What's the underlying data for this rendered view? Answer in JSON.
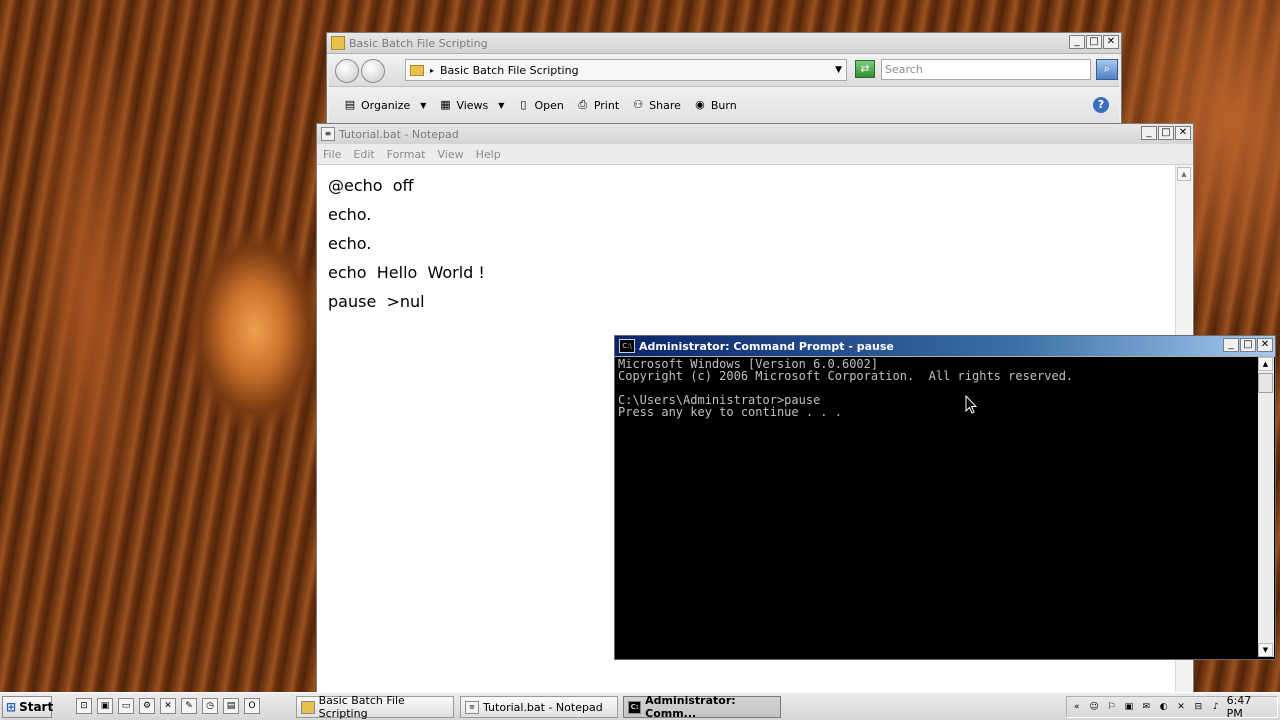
{
  "explorer": {
    "title": "Basic Batch File Scripting",
    "address": "Basic Batch File Scripting",
    "search_placeholder": "Search",
    "toolbar": {
      "organize": "Organize",
      "views": "Views",
      "open": "Open",
      "print": "Print",
      "share": "Share",
      "burn": "Burn"
    }
  },
  "notepad": {
    "title": "Tutorial.bat - Notepad",
    "menu": [
      "File",
      "Edit",
      "Format",
      "View",
      "Help"
    ],
    "lines": [
      "@echo  off",
      "echo.",
      "echo.",
      "echo  Hello  World !",
      "pause  >nul"
    ]
  },
  "cmd": {
    "title": "Administrator: Command Prompt - pause",
    "lines": [
      "Microsoft Windows [Version 6.0.6002]",
      "Copyright (c) 2006 Microsoft Corporation.  All rights reserved.",
      "",
      "C:\\Users\\Administrator>pause",
      "Press any key to continue . . ."
    ]
  },
  "taskbar": {
    "start": "Start",
    "items": [
      "Basic Batch File Scripting",
      "Tutorial.bat - Notepad",
      "Administrator: Comm..."
    ],
    "clock": "6:47 PM"
  },
  "icons": {
    "folder": "folder-icon",
    "back": "back-icon",
    "forward": "forward-icon",
    "go": "go-refresh-icon",
    "search": "search-icon",
    "help": "help-icon",
    "cmd": "command-prompt-icon",
    "notepad": "notepad-icon"
  }
}
